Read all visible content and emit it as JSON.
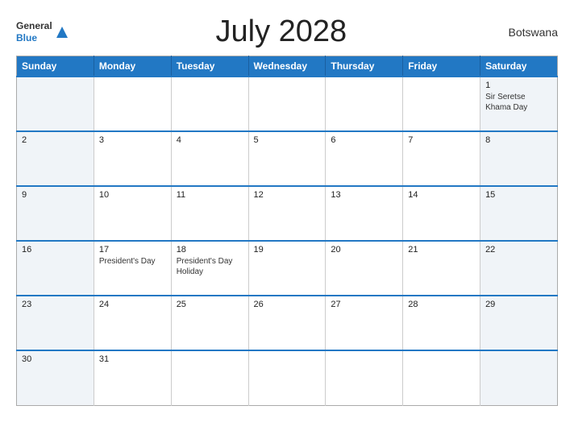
{
  "header": {
    "title": "July 2028",
    "country": "Botswana",
    "logo_general": "General",
    "logo_blue": "Blue"
  },
  "weekdays": [
    "Sunday",
    "Monday",
    "Tuesday",
    "Wednesday",
    "Thursday",
    "Friday",
    "Saturday"
  ],
  "weeks": [
    [
      {
        "day": "",
        "event": ""
      },
      {
        "day": "",
        "event": ""
      },
      {
        "day": "",
        "event": ""
      },
      {
        "day": "",
        "event": ""
      },
      {
        "day": "",
        "event": ""
      },
      {
        "day": "",
        "event": ""
      },
      {
        "day": "1",
        "event": "Sir Seretse Khama Day"
      }
    ],
    [
      {
        "day": "2",
        "event": ""
      },
      {
        "day": "3",
        "event": ""
      },
      {
        "day": "4",
        "event": ""
      },
      {
        "day": "5",
        "event": ""
      },
      {
        "day": "6",
        "event": ""
      },
      {
        "day": "7",
        "event": ""
      },
      {
        "day": "8",
        "event": ""
      }
    ],
    [
      {
        "day": "9",
        "event": ""
      },
      {
        "day": "10",
        "event": ""
      },
      {
        "day": "11",
        "event": ""
      },
      {
        "day": "12",
        "event": ""
      },
      {
        "day": "13",
        "event": ""
      },
      {
        "day": "14",
        "event": ""
      },
      {
        "day": "15",
        "event": ""
      }
    ],
    [
      {
        "day": "16",
        "event": ""
      },
      {
        "day": "17",
        "event": "President's Day"
      },
      {
        "day": "18",
        "event": "President's Day Holiday"
      },
      {
        "day": "19",
        "event": ""
      },
      {
        "day": "20",
        "event": ""
      },
      {
        "day": "21",
        "event": ""
      },
      {
        "day": "22",
        "event": ""
      }
    ],
    [
      {
        "day": "23",
        "event": ""
      },
      {
        "day": "24",
        "event": ""
      },
      {
        "day": "25",
        "event": ""
      },
      {
        "day": "26",
        "event": ""
      },
      {
        "day": "27",
        "event": ""
      },
      {
        "day": "28",
        "event": ""
      },
      {
        "day": "29",
        "event": ""
      }
    ],
    [
      {
        "day": "30",
        "event": ""
      },
      {
        "day": "31",
        "event": ""
      },
      {
        "day": "",
        "event": ""
      },
      {
        "day": "",
        "event": ""
      },
      {
        "day": "",
        "event": ""
      },
      {
        "day": "",
        "event": ""
      },
      {
        "day": "",
        "event": ""
      }
    ]
  ]
}
